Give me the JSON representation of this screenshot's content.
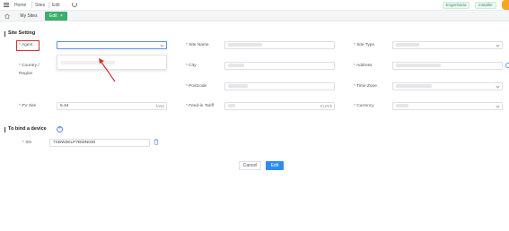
{
  "topbar": {
    "breadcrumb": [
      "Home",
      "Sites",
      "Edit"
    ],
    "roles": [
      "Engenharia",
      "Installer"
    ]
  },
  "tabs": {
    "plain": "My Sites",
    "active": "Edit",
    "active_close": "×"
  },
  "site_setting": {
    "title": "Site Setting",
    "agent_label": "Agent",
    "site_name_label": "Site Name",
    "site_type_label": "Site Type",
    "country_label": "Country /",
    "region_label": "Region",
    "city_label": "City",
    "address_label": "Address",
    "postcode_label": "Postcode",
    "timezone_label": "Time Zone",
    "pv_label": "PV Site",
    "pv_value": "5.34",
    "pv_unit": "kWp",
    "tariff_label": "Feed-in Tariff",
    "tariff_unit": "EUR/k",
    "currency_label": "Currency"
  },
  "bind_device": {
    "title": "To bind a device",
    "add_symbol": "+",
    "sn_label": "SN",
    "sn_value": "7XBW2ELP7BWN030"
  },
  "actions": {
    "cancel": "Cancel",
    "edit": "Edit"
  },
  "annotation_color": "#d42f2f",
  "accent": "#3dae6d",
  "primary": "#2d8cf0"
}
